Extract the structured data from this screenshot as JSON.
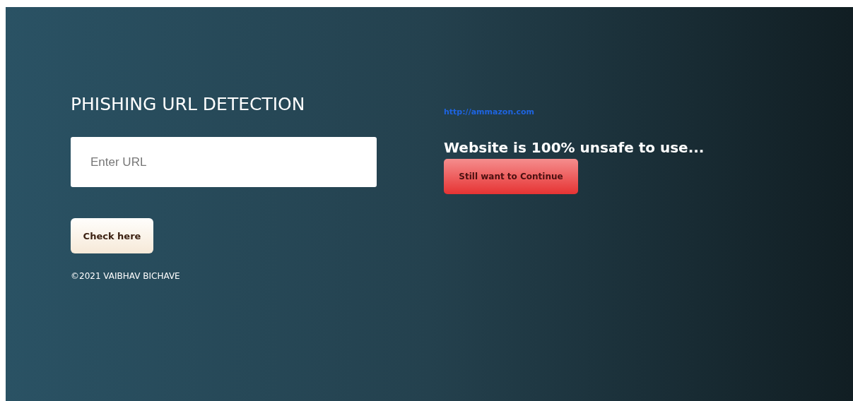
{
  "title": "PHISHING URL DETECTION",
  "url_field": {
    "placeholder": "Enter URL"
  },
  "check_button": "Check here",
  "footer": "©2021 VAIBHAV BICHAVE",
  "result": {
    "url": "http://ammazon.com",
    "message": "Website is 100% unsafe to use...",
    "continue_button": "Still want to Continue"
  }
}
